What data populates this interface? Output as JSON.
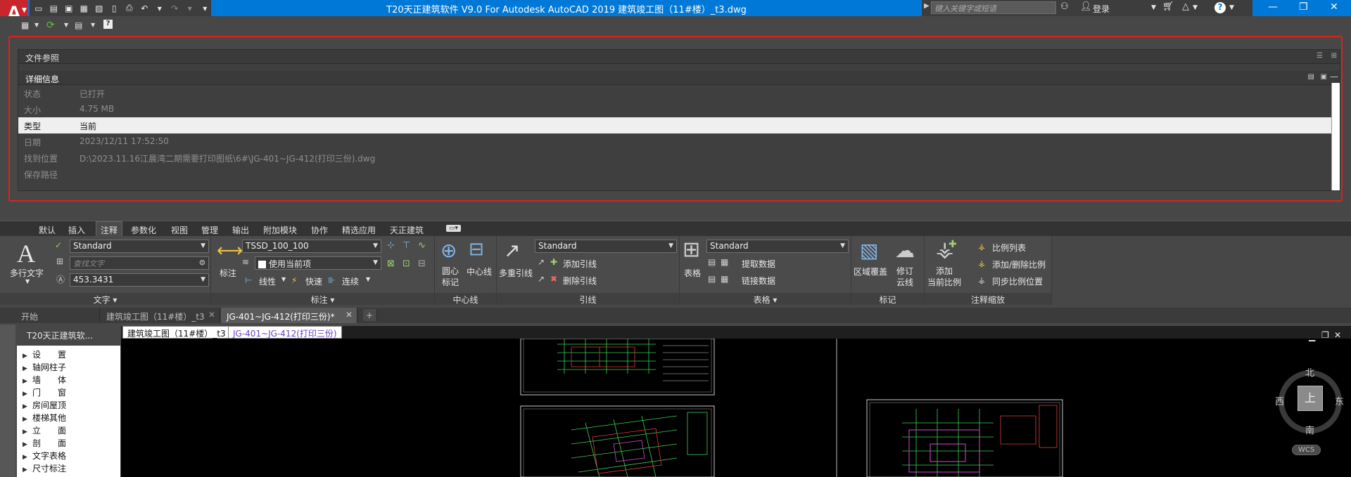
{
  "titlebar": {
    "logo": "A",
    "title": "T20天正建筑软件 V9.0 For Autodesk AutoCAD 2019    建筑竣工图（11#楼）_t3.dwg",
    "search_placeholder": "键入关键字或短语",
    "login": "登录",
    "help": "?"
  },
  "reference_panel": {
    "header": "文件参照",
    "details_header": "详细信息",
    "rows": [
      {
        "key": "状态",
        "value": "已打开"
      },
      {
        "key": "大小",
        "value": "4.75 MB"
      },
      {
        "key": "类型",
        "value": "当前"
      },
      {
        "key": "日期",
        "value": "2023/12/11 17:52:50"
      },
      {
        "key": "找到位置",
        "value": "D:\\2023.11.16江晨湾二期需要打印图纸\\6#\\JG-401~JG-412(打印三份).dwg"
      },
      {
        "key": "保存路径",
        "value": ""
      }
    ]
  },
  "ribbon_tabs": [
    "默认",
    "插入",
    "注释",
    "参数化",
    "视图",
    "管理",
    "输出",
    "附加模块",
    "协作",
    "精选应用",
    "天正建筑"
  ],
  "ribbon": {
    "text_group": {
      "label": "文字",
      "mtext": "多行文字",
      "style": "Standard",
      "find_placeholder": "查找文字",
      "height": "453.3431"
    },
    "dim_group": {
      "label": "标注",
      "dim": "标注",
      "style": "TSSD_100_100",
      "layer": "使用当前项",
      "linear": "线性",
      "quick": "快速",
      "continue": "连续"
    },
    "center_group": {
      "label": "中心线",
      "center_mark": "圆心\n标记",
      "centerline": "中心线"
    },
    "leader_group": {
      "label": "引线",
      "mleader": "多重引线",
      "style": "Standard",
      "add": "添加引线",
      "remove": "删除引线"
    },
    "table_group": {
      "label": "表格",
      "table": "表格",
      "style": "Standard",
      "extract": "提取数据",
      "link": "链接数据"
    },
    "markup_group": {
      "label": "标记",
      "wipeout": "区域覆盖",
      "revcloud": "修订\n云线"
    },
    "scale_group": {
      "label": "注释缩放",
      "add": "添加\n当前比例",
      "list": "比例列表",
      "addremove": "添加/删除比例",
      "sync": "同步比例位置"
    }
  },
  "doc_tabs": [
    "开始",
    "建筑竣工图（11#楼）_t3",
    "JG-401~JG-412(打印三份)*"
  ],
  "drawing_tabs": [
    "建筑竣工图（11#楼）_t3",
    "JG-401~JG-412(打印三份)"
  ],
  "palette": {
    "title": "T20天正建筑软...",
    "items": [
      "设　　置",
      "轴网柱子",
      "墙　　体",
      "门　　窗",
      "房间屋顶",
      "楼梯其他",
      "立　　面",
      "剖　　面",
      "文字表格",
      "尺寸标注"
    ]
  },
  "viewcube": {
    "north": "北",
    "south": "南",
    "east": "东",
    "west": "西",
    "top": "上",
    "wcs": "WCS"
  },
  "colors": {
    "accent": "#0078d7",
    "logo": "#c8262c",
    "frame": "#d8231f"
  }
}
